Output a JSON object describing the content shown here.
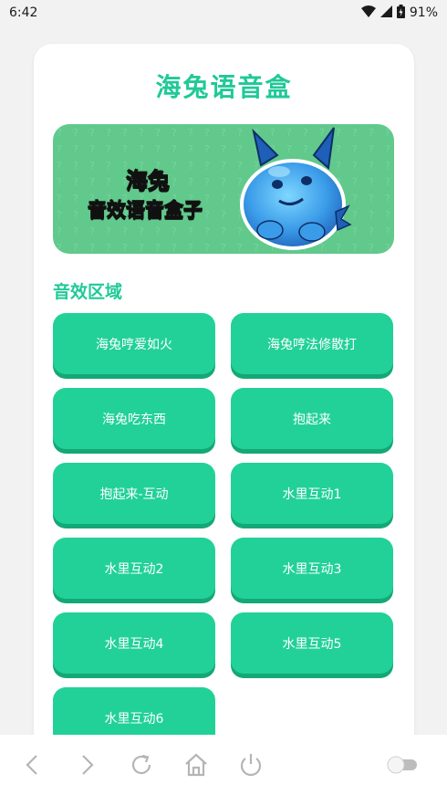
{
  "status": {
    "time": "6:42",
    "battery": "91%"
  },
  "app": {
    "title": "海兔语音盒"
  },
  "banner": {
    "line1": "海兔",
    "line2": "音效语音盒子"
  },
  "section": {
    "title": "音效区域"
  },
  "sounds": [
    {
      "label": "海兔哼爱如火"
    },
    {
      "label": "海兔哼法修散打"
    },
    {
      "label": "海兔吃东西"
    },
    {
      "label": "抱起来"
    },
    {
      "label": "抱起来-互动"
    },
    {
      "label": "水里互动1"
    },
    {
      "label": "水里互动2"
    },
    {
      "label": "水里互动3"
    },
    {
      "label": "水里互动4"
    },
    {
      "label": "水里互动5"
    },
    {
      "label": "水里互动6"
    }
  ],
  "bottom_nav": {
    "icons": [
      "back-icon",
      "forward-icon",
      "refresh-icon",
      "home-icon",
      "power-icon",
      "toggle-switch"
    ]
  },
  "colors": {
    "accent": "#20c997",
    "button": "#22d197",
    "button_shadow": "#14a877",
    "banner": "#61c98b"
  }
}
